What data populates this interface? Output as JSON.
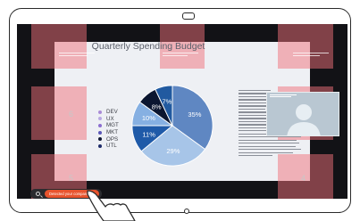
{
  "slide": {
    "title": "Quarterly Spending Budget"
  },
  "zones": {
    "top_left": "",
    "top_center": "",
    "top_right": "",
    "mid_left": "6",
    "bottom_left": "5",
    "bottom_right": "4"
  },
  "legend": [
    {
      "label": "DEV",
      "color": "#a98bd6"
    },
    {
      "label": "UX",
      "color": "#b8a8e2"
    },
    {
      "label": "MGT",
      "color": "#8c6fd0"
    },
    {
      "label": "MKT",
      "color": "#5b57b8"
    },
    {
      "label": "OPS",
      "color": "#0f1733"
    },
    {
      "label": "UTL",
      "color": "#1e2c6a"
    }
  ],
  "chart_data": {
    "type": "pie",
    "labels": [
      "35%",
      "29%",
      "11%",
      "10%",
      "8%",
      "7%"
    ],
    "values": [
      35,
      29,
      11,
      10,
      8,
      7
    ],
    "colors": [
      "#5f87c2",
      "#a7c5e8",
      "#1f5aa8",
      "#86b0e2",
      "#0b1630",
      "#215aa0"
    ]
  },
  "bottom_bar": {
    "companion_label": "Detected your companion"
  }
}
